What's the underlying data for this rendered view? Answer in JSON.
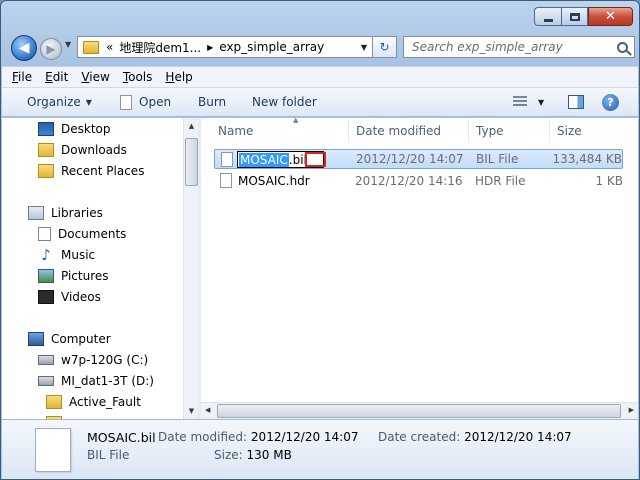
{
  "window": {
    "caption": {
      "minimize": "minimize",
      "maximize": "maximize",
      "close": "✕"
    }
  },
  "address": {
    "overflow": "«",
    "segments": [
      "地理院dem1...",
      "exp_simple_array"
    ],
    "search_placeholder": "Search exp_simple_array"
  },
  "menu": {
    "items": [
      {
        "accel": "F",
        "rest": "ile"
      },
      {
        "accel": "E",
        "rest": "dit"
      },
      {
        "accel": "V",
        "rest": "iew"
      },
      {
        "accel": "T",
        "rest": "ools"
      },
      {
        "accel": "H",
        "rest": "elp"
      }
    ]
  },
  "toolbar": {
    "organize": "Organize",
    "open": "Open",
    "burn": "Burn",
    "new_folder": "New folder",
    "help": "?"
  },
  "nav": {
    "items": [
      {
        "label": "Desktop",
        "icon": "desktop-icon"
      },
      {
        "label": "Downloads",
        "icon": "downloads-folder-icon"
      },
      {
        "label": "Recent Places",
        "icon": "recent-places-icon"
      },
      {
        "label": "Libraries",
        "icon": "libraries-icon"
      },
      {
        "label": "Documents",
        "icon": "documents-icon"
      },
      {
        "label": "Music",
        "icon": "music-icon"
      },
      {
        "label": "Pictures",
        "icon": "pictures-icon"
      },
      {
        "label": "Videos",
        "icon": "videos-icon"
      },
      {
        "label": "Computer",
        "icon": "computer-icon"
      },
      {
        "label": "w7p-120G (C:)",
        "icon": "system-drive-icon"
      },
      {
        "label": "MI_dat1-3T (D:)",
        "icon": "drive-icon"
      },
      {
        "label": "Active_Fault",
        "icon": "folder-icon"
      }
    ]
  },
  "filelist": {
    "columns": {
      "name": "Name",
      "date": "Date modified",
      "type": "Type",
      "size": "Size"
    },
    "rows": [
      {
        "name_selected": "MOSAIC",
        "name_rest": ".bil",
        "date": "2012/12/20 14:07",
        "type": "BIL File",
        "size": "133,484 KB",
        "renaming": true
      },
      {
        "name": "MOSAIC.hdr",
        "date": "2012/12/20 14:16",
        "type": "HDR File",
        "size": "1 KB",
        "renaming": false
      }
    ]
  },
  "details": {
    "name": "MOSAIC.bil",
    "type": "BIL File",
    "modified_label": "Date modified:",
    "modified_value": "2012/12/20 14:07",
    "size_label": "Size:",
    "size_value": "130 MB",
    "created_label": "Date created:",
    "created_value": "2012/12/20 14:07"
  }
}
